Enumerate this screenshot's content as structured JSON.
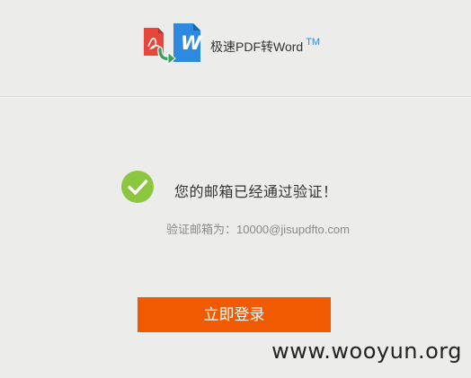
{
  "header": {
    "app_name": "极速PDF转Word",
    "trademark": "TM"
  },
  "main": {
    "success_message": "您的邮箱已经通过验证！",
    "email_label": "验证邮箱为：",
    "email_value": "10000@jisupdfto.com",
    "login_button": "立即登录"
  },
  "watermark": "www.wooyun.org",
  "colors": {
    "accent_orange": "#f05a00",
    "success_green": "#8cc63f",
    "brand_blue": "#2d8ae0",
    "pdf_red": "#e8463a"
  },
  "icons": {
    "logo": "pdf-to-word-logo-icon",
    "success": "check-circle-icon"
  }
}
